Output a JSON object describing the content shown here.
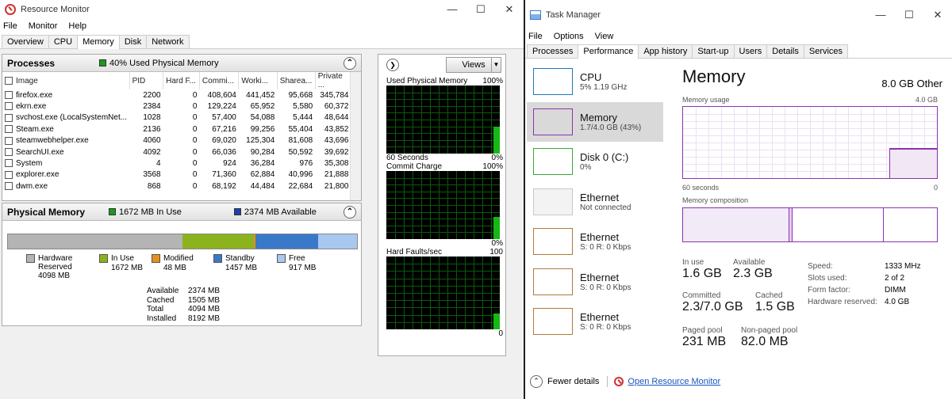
{
  "resource_monitor": {
    "title": "Resource Monitor",
    "menu": [
      "File",
      "Monitor",
      "Help"
    ],
    "tabs": [
      "Overview",
      "CPU",
      "Memory",
      "Disk",
      "Network"
    ],
    "active_tab": "Memory",
    "processes": {
      "title": "Processes",
      "status": "40% Used Physical Memory",
      "columns": [
        "Image",
        "PID",
        "Hard F...",
        "Commi...",
        "Worki...",
        "Sharea...",
        "Private ..."
      ],
      "rows": [
        [
          "firefox.exe",
          "2200",
          "0",
          "408,604",
          "441,452",
          "95,668",
          "345,784"
        ],
        [
          "ekrn.exe",
          "2384",
          "0",
          "129,224",
          "65,952",
          "5,580",
          "60,372"
        ],
        [
          "svchost.exe (LocalSystemNet...",
          "1028",
          "0",
          "57,400",
          "54,088",
          "5,444",
          "48,644"
        ],
        [
          "Steam.exe",
          "2136",
          "0",
          "67,216",
          "99,256",
          "55,404",
          "43,852"
        ],
        [
          "steamwebhelper.exe",
          "4060",
          "0",
          "69,020",
          "125,304",
          "81,608",
          "43,696"
        ],
        [
          "SearchUI.exe",
          "4092",
          "0",
          "66,036",
          "90,284",
          "50,592",
          "39,692"
        ],
        [
          "System",
          "4",
          "0",
          "924",
          "36,284",
          "976",
          "35,308"
        ],
        [
          "explorer.exe",
          "3568",
          "0",
          "71,360",
          "62,884",
          "40,996",
          "21,888"
        ],
        [
          "dwm.exe",
          "868",
          "0",
          "68,192",
          "44,484",
          "22,684",
          "21,800"
        ]
      ]
    },
    "physical_memory": {
      "title": "Physical Memory",
      "in_use_label": "1672 MB In Use",
      "available_label": "2374 MB Available",
      "legend": [
        {
          "name": "Hardware\nReserved",
          "value": "4098 MB",
          "color": "#b4b4b4"
        },
        {
          "name": "In Use",
          "value": "1672 MB",
          "color": "#8cb31d"
        },
        {
          "name": "Modified",
          "value": "48 MB",
          "color": "#e8901e"
        },
        {
          "name": "Standby",
          "value": "1457 MB",
          "color": "#3a78c9"
        },
        {
          "name": "Free",
          "value": "917 MB",
          "color": "#a8c8f0"
        }
      ],
      "summary": [
        {
          "k": "Available",
          "v": "2374 MB"
        },
        {
          "k": "Cached",
          "v": "1505 MB"
        },
        {
          "k": "Total",
          "v": "4094 MB"
        },
        {
          "k": "Installed",
          "v": "8192 MB"
        }
      ]
    },
    "graphs": {
      "views_label": "Views",
      "items": [
        {
          "title": "Used Physical Memory",
          "top": "100%",
          "foot_left": "60 Seconds",
          "foot_right": "0%"
        },
        {
          "title": "Commit Charge",
          "top": "100%",
          "foot_left": "",
          "foot_right": "0%"
        },
        {
          "title": "Hard Faults/sec",
          "top": "100",
          "foot_left": "",
          "foot_right": "0"
        }
      ]
    }
  },
  "task_manager": {
    "title": "Task Manager",
    "menu": [
      "File",
      "Options",
      "View"
    ],
    "tabs": [
      "Processes",
      "Performance",
      "App history",
      "Start-up",
      "Users",
      "Details",
      "Services"
    ],
    "active_tab": "Performance",
    "sidebar": [
      {
        "title": "CPU",
        "sub": "5% 1.19 GHz",
        "color": "#1c78c0"
      },
      {
        "title": "Memory",
        "sub": "1.7/4.0 GB (43%)",
        "color": "#8b32b0"
      },
      {
        "title": "Disk 0 (C:)",
        "sub": "0%",
        "color": "#3aa838"
      },
      {
        "title": "Ethernet",
        "sub": "Not connected",
        "color": "#c8c8c8"
      },
      {
        "title": "Ethernet",
        "sub": "S: 0 R: 0 Kbps",
        "color": "#b07a3a"
      },
      {
        "title": "Ethernet",
        "sub": "S: 0 R: 0 Kbps",
        "color": "#b07a3a"
      },
      {
        "title": "Ethernet",
        "sub": "S: 0 R: 0 Kbps",
        "color": "#b07a3a"
      }
    ],
    "memory": {
      "title": "Memory",
      "other": "8.0 GB Other",
      "usage_label": "Memory usage",
      "usage_max": "4.0 GB",
      "time_left": "60 seconds",
      "time_right": "0",
      "composition_label": "Memory composition",
      "stats": {
        "in_use_k": "In use",
        "in_use_v": "1.6 GB",
        "available_k": "Available",
        "available_v": "2.3 GB",
        "committed_k": "Committed",
        "committed_v": "2.3/7.0 GB",
        "cached_k": "Cached",
        "cached_v": "1.5 GB",
        "paged_k": "Paged pool",
        "paged_v": "231 MB",
        "nonpaged_k": "Non-paged pool",
        "nonpaged_v": "82.0 MB"
      },
      "details": [
        {
          "k": "Speed:",
          "v": "1333 MHz"
        },
        {
          "k": "Slots used:",
          "v": "2 of 2"
        },
        {
          "k": "Form factor:",
          "v": "DIMM"
        },
        {
          "k": "Hardware reserved:",
          "v": "4.0 GB"
        }
      ]
    },
    "footer": {
      "fewer": "Fewer details",
      "open_rm": "Open Resource Monitor"
    }
  }
}
